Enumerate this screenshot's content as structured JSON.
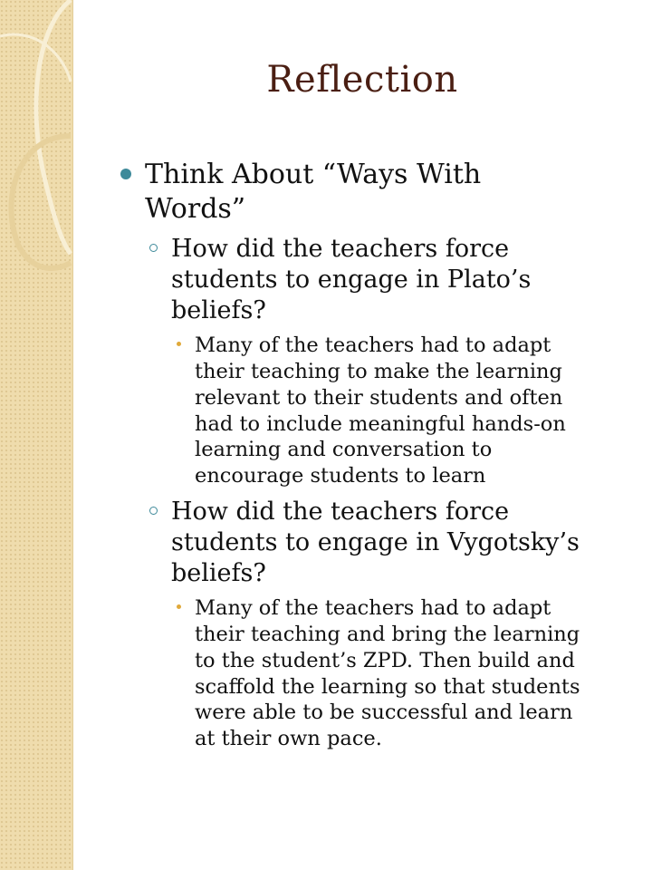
{
  "slide": {
    "title": "Reflection",
    "bullet_l1": {
      "lines": [
        "Think About “Ways With",
        "Words”"
      ]
    },
    "sub1": {
      "lines": [
        "How did the teachers force",
        "students to engage in Plato’s",
        "beliefs?"
      ],
      "detail_lines": [
        "Many of the teachers had to adapt",
        "their teaching to make the learning",
        "relevant to their students and often",
        "had to include meaningful hands-on",
        "learning and conversation to",
        "encourage students to learn"
      ]
    },
    "sub2": {
      "lines": [
        "How did the teachers force",
        "students to engage in Vygotsky’s",
        "beliefs?"
      ],
      "detail_lines": [
        "Many of the teachers had to adapt",
        "their teaching and bring the learning",
        "to the student’s ZPD. Then build and",
        "scaffold the learning so that students",
        "were able to be successful and learn",
        "at their own pace."
      ]
    }
  },
  "colors": {
    "title": "#4a1e12",
    "bullet_l1": "#3e8a9a",
    "bullet_l3": "#e0a93a",
    "side_band": "#efdcad"
  }
}
